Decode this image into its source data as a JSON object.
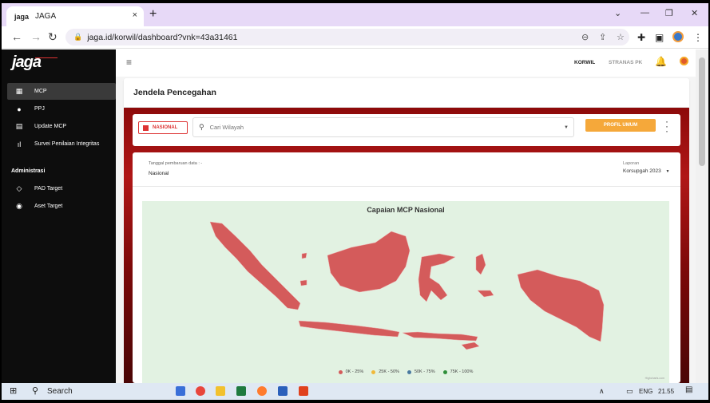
{
  "browser": {
    "tab": {
      "favicon_text": "jaga",
      "title": "JAGA",
      "close": "×"
    },
    "new_tab": "+",
    "url": "jaga.id/korwil/dashboard?vnk=43a31461"
  },
  "app": {
    "logo": "jaga",
    "sidebar": {
      "items": [
        {
          "label": "MCP",
          "icon": "dashboard-icon"
        },
        {
          "label": "PPJ",
          "icon": "lightbulb-icon"
        },
        {
          "label": "Update MCP",
          "icon": "document-icon"
        },
        {
          "label": "Survei Penilaian Integritas",
          "icon": "bar-chart-icon"
        }
      ],
      "section_title": "Administrasi",
      "admin_items": [
        {
          "label": "PAD Target",
          "icon": "target-icon"
        },
        {
          "label": "Aset Target",
          "icon": "crosshair-icon"
        }
      ]
    },
    "topbar": {
      "link1": "KORWIL",
      "link2": "STRANAS PK"
    },
    "page_title": "Jendela Pencegahan",
    "filter": {
      "nasional_label": "NASIONAL",
      "search_placeholder": "Cari Wilayah",
      "profil_button": "PROFIL UMUM"
    },
    "info": {
      "update_label": "Tanggal pembaruan data : -",
      "update_value": "Nasional",
      "laporan_label": "Laporan",
      "laporan_value": "Korsupgah 2023"
    },
    "map": {
      "title": "Capaian MCP Nasional",
      "credit": "Highcharts.com",
      "legend": [
        {
          "label": "0K - 25%",
          "color": "#d45b5b"
        },
        {
          "label": "25K - 50%",
          "color": "#f0b93a"
        },
        {
          "label": "50K - 75%",
          "color": "#4a7aa0"
        },
        {
          "label": "75K - 100%",
          "color": "#2f8f3a"
        }
      ]
    }
  },
  "taskbar": {
    "search": "Search",
    "lang": "ENG",
    "time": "21.55"
  },
  "colors": {
    "accent": "#d32f2f",
    "orange": "#f5a83a",
    "map_fill": "#d45b5b",
    "sidebar": "#0d0d0d"
  }
}
